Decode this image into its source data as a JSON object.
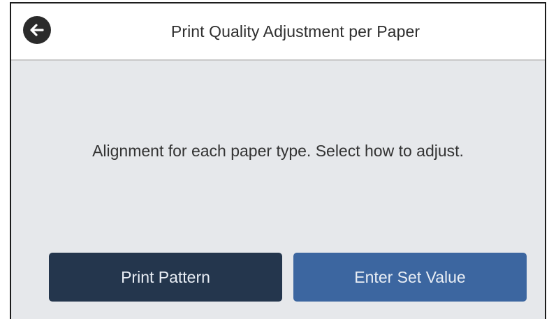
{
  "header": {
    "title": "Print Quality Adjustment per Paper",
    "back_icon": "arrow-left-circle-icon"
  },
  "main": {
    "message": "Alignment for each paper type. Select how to adjust."
  },
  "buttons": {
    "print_pattern": "Print Pattern",
    "enter_set_value": "Enter Set Value"
  },
  "colors": {
    "background": "#e6e8eb",
    "header_background": "#ffffff",
    "primary_dark_button": "#24364d",
    "primary_blue_button": "#3c66a0",
    "button_text": "#e9eef5"
  }
}
